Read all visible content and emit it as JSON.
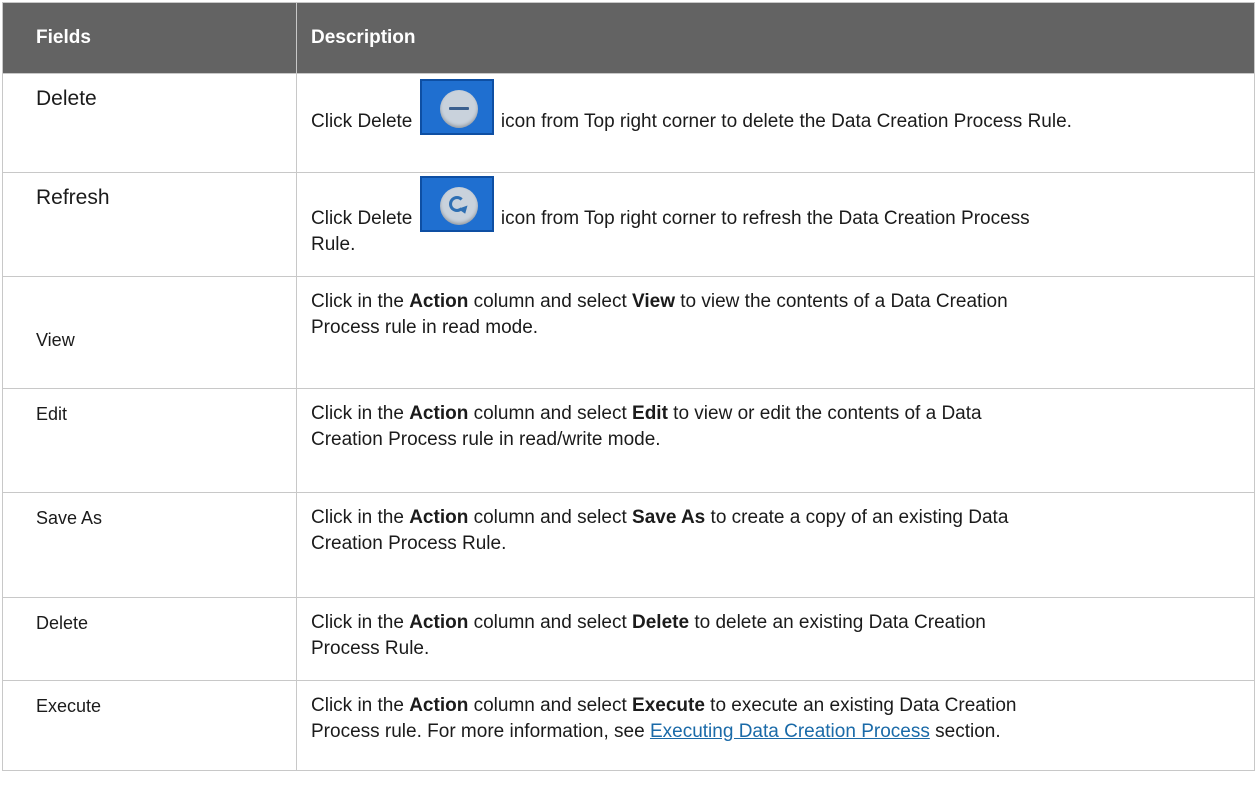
{
  "header": {
    "fields": "Fields",
    "description": "Description"
  },
  "rows": [
    {
      "field": "Delete",
      "pre": "Click Delete ",
      "icon": "minus-circle-icon",
      "post": " icon from Top right corner to delete the Data Creation Process Rule."
    },
    {
      "field": "Refresh",
      "pre": "Click Delete ",
      "icon": "refresh-circle-icon",
      "post": " icon from Top right corner to refresh the Data Creation Process",
      "post2": "Rule."
    },
    {
      "field": "View",
      "a": "Click in the ",
      "b1": "Action",
      "c": " column and select ",
      "b2": "View",
      "d": " to view the contents of a Data Creation",
      "e": "Process rule in read mode."
    },
    {
      "field": "Edit",
      "a": "Click in the ",
      "b1": "Action",
      "c": " column and select ",
      "b2": "Edit",
      "d": " to view or edit the contents of a Data",
      "e": "Creation Process rule in read/write mode."
    },
    {
      "field": "Save As",
      "a": "Click in the ",
      "b1": "Action",
      "c": " column and select ",
      "b2": "Save As",
      "d": " to create a copy of an existing Data",
      "e": "Creation Process Rule."
    },
    {
      "field": "Delete",
      "a": "Click in the ",
      "b1": "Action",
      "c": " column and select ",
      "b2": "Delete",
      "d": " to delete an existing Data Creation",
      "e": "Process Rule."
    },
    {
      "field": "Execute",
      "a": "Click in the ",
      "b1": "Action",
      "c": " column and select ",
      "b2": "Execute",
      "d": " to execute an existing Data Creation",
      "e": "Process rule. For more information, see ",
      "link": "Executing Data Creation Process",
      "f": " section."
    }
  ]
}
